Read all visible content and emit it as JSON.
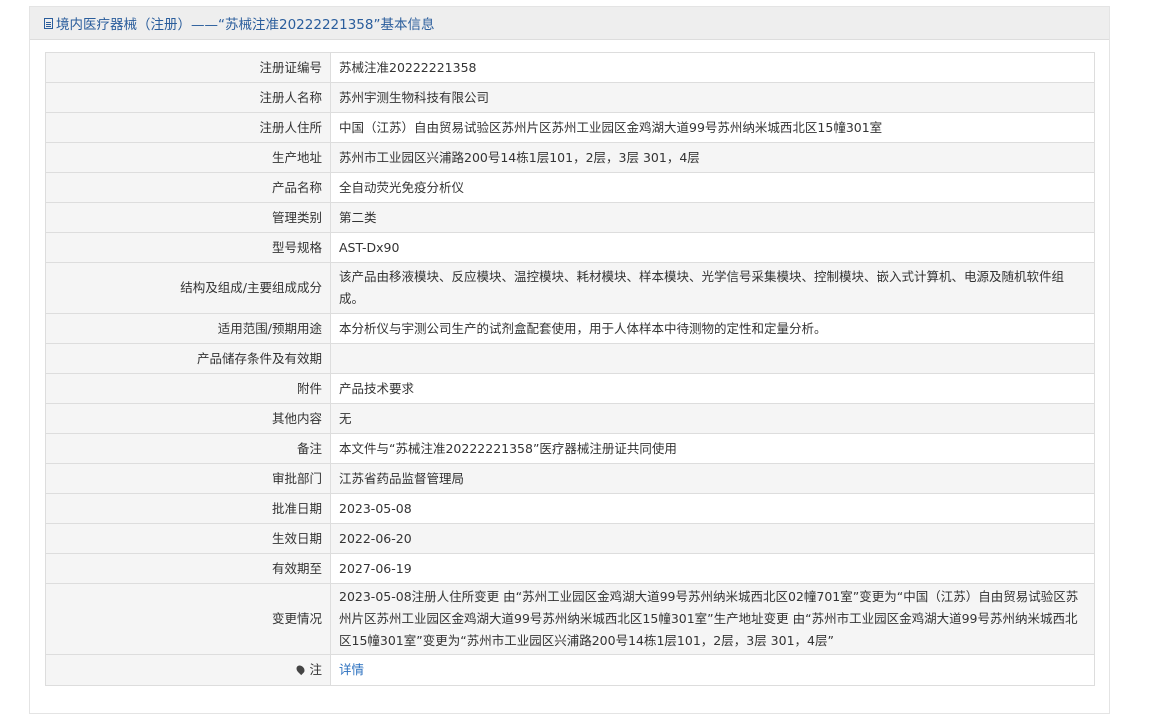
{
  "header": {
    "title": "境内医疗器械（注册）——“苏械注准20222221358”基本信息",
    "icon": "document-icon"
  },
  "rows": [
    {
      "label": "注册证编号",
      "value": "苏械注准20222221358"
    },
    {
      "label": "注册人名称",
      "value": "苏州宇测生物科技有限公司"
    },
    {
      "label": "注册人住所",
      "value": "中国（江苏）自由贸易试验区苏州片区苏州工业园区金鸡湖大道99号苏州纳米城西北区15幢301室"
    },
    {
      "label": "生产地址",
      "value": "苏州市工业园区兴浦路200号14栋1层101，2层，3层 301，4层"
    },
    {
      "label": "产品名称",
      "value": "全自动荧光免疫分析仪"
    },
    {
      "label": "管理类别",
      "value": "第二类"
    },
    {
      "label": "型号规格",
      "value": "AST-Dx90"
    },
    {
      "label": "结构及组成/主要组成成分",
      "value": "该产品由移液模块、反应模块、温控模块、耗材模块、样本模块、光学信号采集模块、控制模块、嵌入式计算机、电源及随机软件组成。"
    },
    {
      "label": "适用范围/预期用途",
      "value": "本分析仪与宇测公司生产的试剂盒配套使用，用于人体样本中待测物的定性和定量分析。"
    },
    {
      "label": "产品储存条件及有效期",
      "value": ""
    },
    {
      "label": "附件",
      "value": "产品技术要求"
    },
    {
      "label": "其他内容",
      "value": "无"
    },
    {
      "label": "备注",
      "value": "本文件与“苏械注准20222221358”医疗器械注册证共同使用"
    },
    {
      "label": "审批部门",
      "value": "江苏省药品监督管理局"
    },
    {
      "label": "批准日期",
      "value": "2023-05-08"
    },
    {
      "label": "生效日期",
      "value": "2022-06-20"
    },
    {
      "label": "有效期至",
      "value": "2027-06-19"
    },
    {
      "label": "变更情况",
      "value": "2023-05-08注册人住所变更 由“苏州工业园区金鸡湖大道99号苏州纳米城西北区02幢701室”变更为“中国（江苏）自由贸易试验区苏州片区苏州工业园区金鸡湖大道99号苏州纳米城西北区15幢301室”生产地址变更 由“苏州市工业园区金鸡湖大道99号苏州纳米城西北区15幢301室”变更为“苏州市工业园区兴浦路200号14栋1层101，2层，3层 301，4层”"
    }
  ],
  "note": {
    "label": "注",
    "icon": "pin-icon",
    "link_text": "详情"
  },
  "colors": {
    "accent": "#2a5d9c",
    "link": "#2a6fbf",
    "row_alt": "#f5f5f5",
    "border": "#dddddd"
  }
}
